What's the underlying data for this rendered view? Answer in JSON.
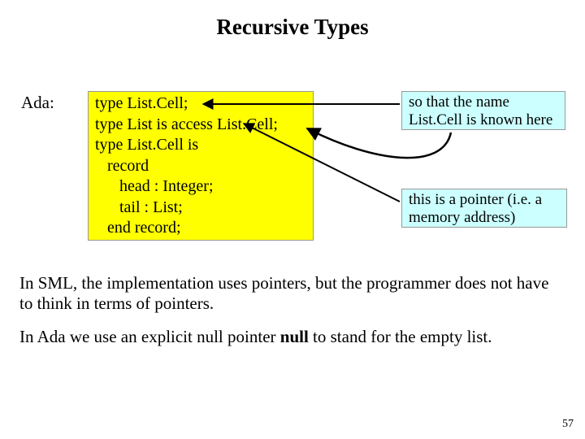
{
  "title": "Recursive Types",
  "ada_label": "Ada:",
  "code": "type List.Cell;\ntype List is access List.Cell;\ntype List.Cell is\n   record\n      head : Integer;\n      tail : List;\n   end record;",
  "note1": "so that the name List.Cell is known here",
  "note2": "this is a pointer\n(i.e. a memory address)",
  "para1": "In SML, the implementation uses pointers, but the programmer does not have to think in terms of pointers.",
  "para2_pre": "In Ada we use an explicit null pointer ",
  "para2_bold": "null",
  "para2_post": " to stand for the empty list.",
  "pagenum": "57"
}
